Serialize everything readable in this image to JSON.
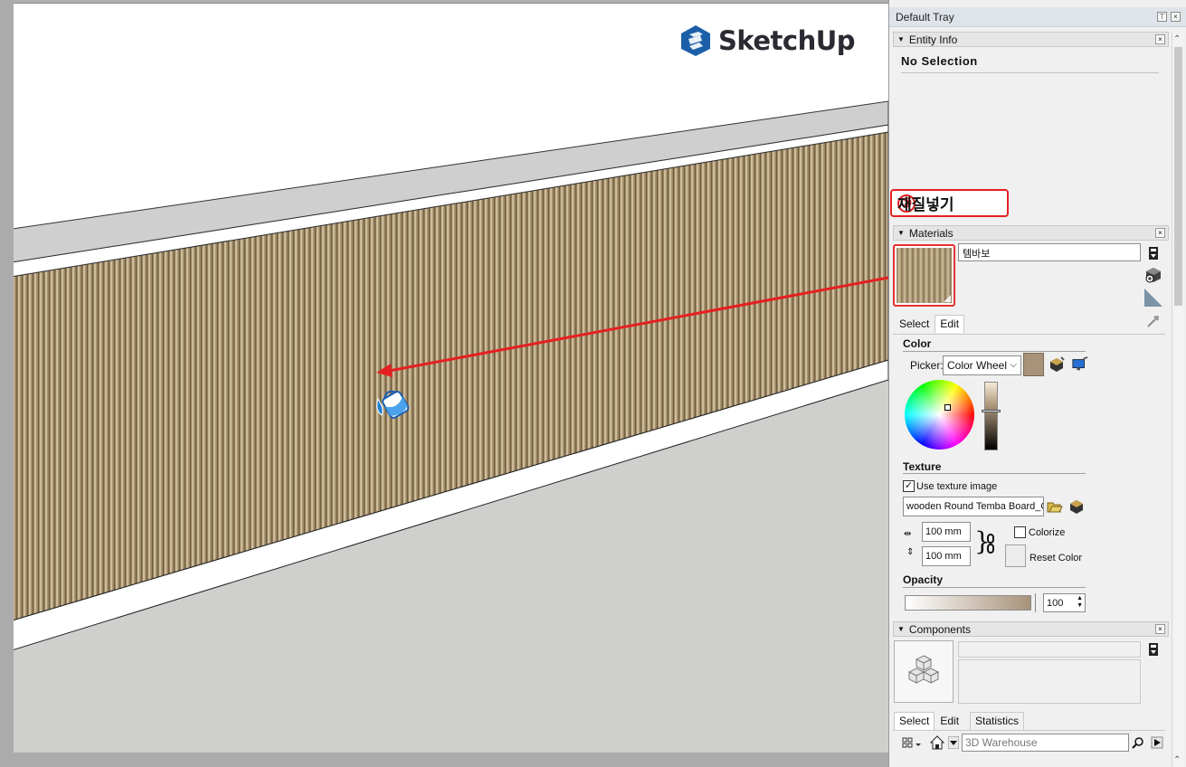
{
  "canvas": {
    "logo_text": "SketchUp",
    "colors": {
      "wood_dark": "#7d6a4d",
      "wood_light": "#cfbf9d",
      "wall_top_gray": "#cfcfcf",
      "floor_gray": "#cfcfcd",
      "arrow_red": "#e52020"
    }
  },
  "annotation": {
    "step_number": "②",
    "step_label": "재질넣기"
  },
  "tray": {
    "title": "Default Tray",
    "entity_info": {
      "header": "Entity Info",
      "selection": "No Selection"
    },
    "materials": {
      "header": "Materials",
      "material_name": "템바보",
      "tabs": [
        "Select",
        "Edit"
      ],
      "active_tab": "Edit",
      "color": {
        "section": "Color",
        "picker_label": "Picker:",
        "picker_value": "Color Wheel",
        "swatch_color": "#a8927a"
      },
      "texture": {
        "section": "Texture",
        "use_texture_label": "Use texture image",
        "use_texture_checked": true,
        "file_name": "wooden Round Temba Board_C",
        "width": "100 mm",
        "height": "100 mm",
        "colorize_label": "Colorize",
        "colorize_checked": false,
        "reset_label": "Reset Color"
      },
      "opacity": {
        "section": "Opacity",
        "value": "100"
      }
    },
    "components": {
      "header": "Components",
      "tabs": [
        "Select",
        "Edit",
        "Statistics"
      ],
      "active_tab": "Select",
      "search_placeholder": "3D Warehouse"
    }
  }
}
